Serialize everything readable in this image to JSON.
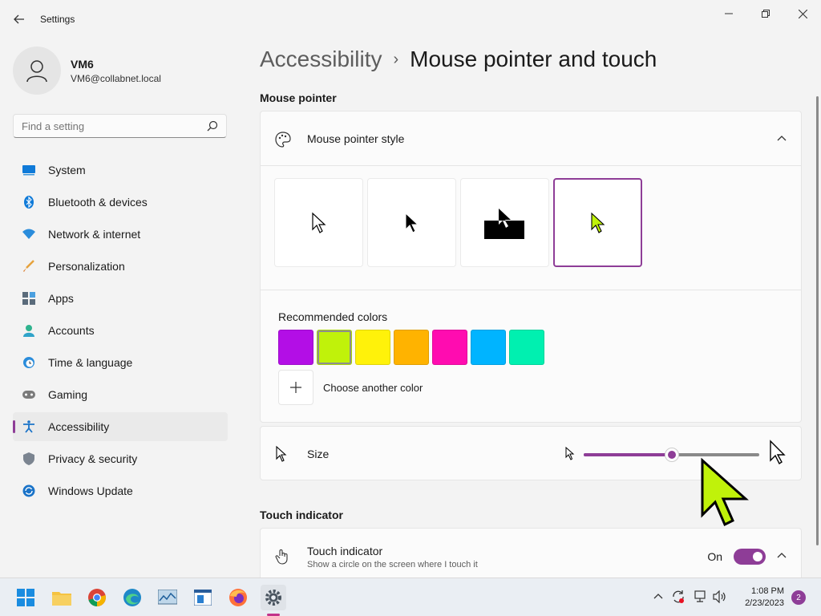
{
  "window": {
    "title": "Settings",
    "back_icon": "back-arrow-icon",
    "min_icon": "minimize-icon",
    "max_icon": "maximize-icon",
    "close_icon": "close-icon"
  },
  "profile": {
    "name": "VM6",
    "email": "VM6@collabnet.local"
  },
  "search": {
    "placeholder": "Find a setting"
  },
  "sidebar": {
    "items": [
      {
        "label": "System",
        "icon": "system-icon"
      },
      {
        "label": "Bluetooth & devices",
        "icon": "bluetooth-icon"
      },
      {
        "label": "Network & internet",
        "icon": "network-icon"
      },
      {
        "label": "Personalization",
        "icon": "brush-icon"
      },
      {
        "label": "Apps",
        "icon": "apps-icon"
      },
      {
        "label": "Accounts",
        "icon": "accounts-icon"
      },
      {
        "label": "Time & language",
        "icon": "clock-globe-icon"
      },
      {
        "label": "Gaming",
        "icon": "gamepad-icon"
      },
      {
        "label": "Accessibility",
        "icon": "accessibility-icon",
        "active": true
      },
      {
        "label": "Privacy & security",
        "icon": "shield-icon"
      },
      {
        "label": "Windows Update",
        "icon": "update-icon"
      }
    ]
  },
  "breadcrumb": {
    "parent": "Accessibility",
    "separator": "›",
    "current": "Mouse pointer and touch"
  },
  "mouse_pointer": {
    "section_title": "Mouse pointer",
    "style_label": "Mouse pointer style",
    "styles": [
      "white",
      "black",
      "inverted",
      "custom"
    ],
    "selected_style": "custom",
    "recommended_label": "Recommended colors",
    "colors": [
      "#b30ee6",
      "#c0f20a",
      "#fff20a",
      "#ffb300",
      "#ff0cb0",
      "#00b4ff",
      "#00f0b0"
    ],
    "selected_color": "#c0f20a",
    "choose_label": "Choose another color",
    "size_label": "Size",
    "size_fraction": 0.5
  },
  "touch": {
    "section_title": "Touch indicator",
    "label": "Touch indicator",
    "description": "Show a circle on the screen where I touch it",
    "state": "On"
  },
  "taskbar": {
    "time": "1:08 PM",
    "date": "2/23/2023",
    "notifications": "2"
  }
}
